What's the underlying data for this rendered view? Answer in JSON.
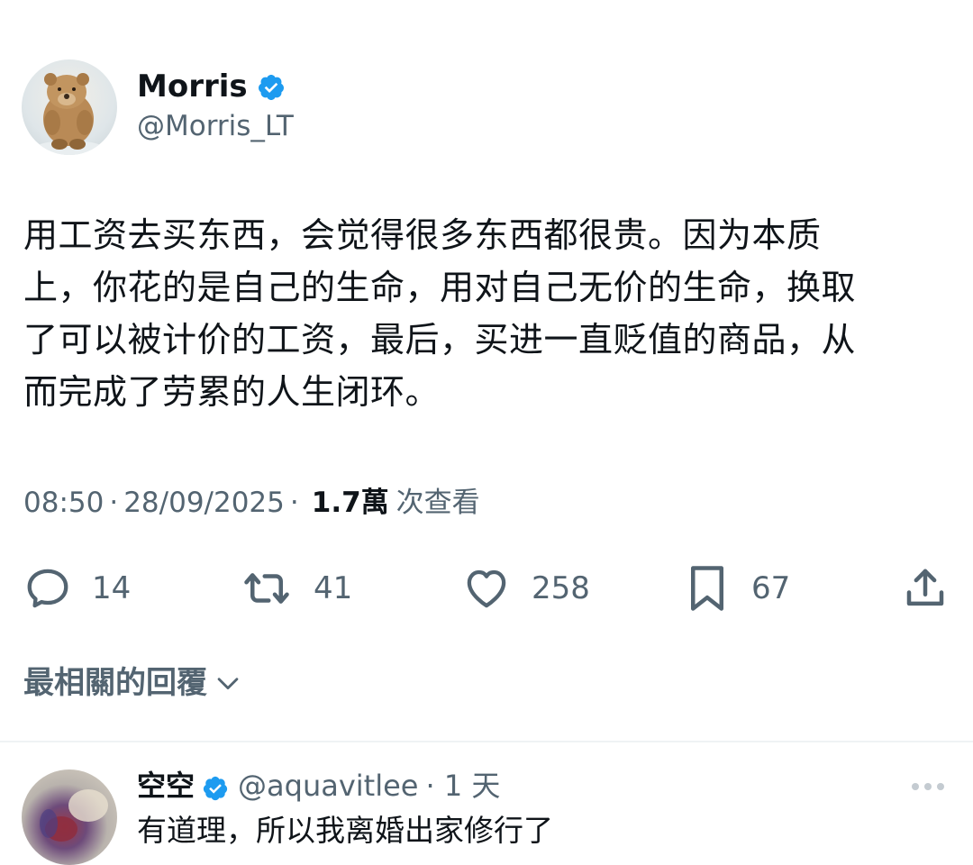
{
  "tweet": {
    "author": {
      "name": "Morris",
      "handle": "@Morris_LT",
      "verified": true,
      "avatar_icon": "bear-avatar"
    },
    "text": "用工资去买东西，会觉得很多东西都很贵。因为本质\n上，你花的是自己的生命，用对自己无价的生命，换取\n了可以被计价的工资，最后，买进一直贬值的商品，从\n而完成了劳累的人生闭环。",
    "time": "08:50",
    "separator": "·",
    "date": "28/09/2025",
    "views_count": "1.7萬",
    "views_label": "次查看",
    "actions": {
      "replies": "14",
      "reposts": "41",
      "likes": "258",
      "bookmarks": "67"
    }
  },
  "reply_sort": {
    "label": "最相關的回覆"
  },
  "replies": [
    {
      "name": "空空",
      "verified": true,
      "handle": "@aquavitlee",
      "time": "· 1 天",
      "text": "有道理，所以我离婚出家修行了"
    }
  ],
  "colors": {
    "text_primary": "#0f1419",
    "text_secondary": "#536471",
    "verified_blue": "#1d9bf0",
    "divider": "#eff3f4"
  }
}
